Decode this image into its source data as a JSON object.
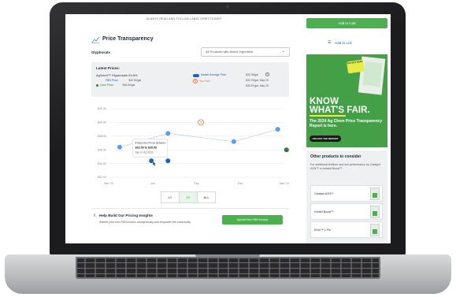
{
  "banner": "ALWAYS READ AND FOLLOW LABEL DIRECTIONS®",
  "header": {
    "title": "Price Transparency"
  },
  "product": {
    "label": "Glyphosate",
    "filter_value": "All Products with Active Ingredient"
  },
  "latest": {
    "title": "Latest Prices:",
    "product_name": "AgSavvi™ Glyphosate 53.8%",
    "fbn_label": "FBN Price:",
    "fbn_value": "$32.50/gal",
    "cash_label": "Cash Price:",
    "cash_value": "$36.50/gal",
    "market_label": "Market Average Price",
    "you_paid_label": "You Paid",
    "market_values": [
      "$32.09/gal",
      "$30.79/gal, May 25",
      "$35.97/gal, May 25"
    ]
  },
  "chart_data": {
    "type": "line",
    "x_labels": [
      "Mar '23",
      "Jun",
      "Sep",
      "Dec",
      "Mar '24"
    ],
    "y_labels": [
      "$32.00",
      "$34.00",
      "$36.00",
      "$38.00",
      "$40.00",
      "$42.00"
    ],
    "ylim": [
      32,
      42
    ],
    "series": [
      {
        "name": "Market Average Price",
        "color": "#5b9cf0",
        "points": [
          {
            "x": 0.25,
            "y": 36.4
          },
          {
            "x": 1.35,
            "y": 38.4
          },
          {
            "x": 2.85,
            "y": 37.2
          },
          {
            "x": 3.85,
            "y": 39.0
          }
        ]
      }
    ],
    "you_paid": {
      "x": 2.1,
      "y": 40.0,
      "color": "#e07a2b"
    },
    "fbn_point": {
      "x": 1.35,
      "y": 34.4,
      "color": "#1565c0"
    },
    "cash_point": {
      "x": 4.05,
      "y": 36.0,
      "color": "#2e7d32"
    },
    "tooltip": {
      "x": 0.8,
      "y": 37.6,
      "line1": "8 Reported Prices Between",
      "line2": "$33.59 to $35.50",
      "line3": "Sep to Oct 2023"
    },
    "grid": true
  },
  "tabs": [
    "1Y",
    "2Y",
    "ALL"
  ],
  "insights": {
    "title": "Help Build Our Pricing Insights",
    "text": "Submit your non-FBN invoice anonymously and empower the community.",
    "upload_label": "Upload Non-FBN Invoice"
  },
  "sidebar": {
    "cart_label": "Add to Cart",
    "list_label": "Add to List",
    "promo": {
      "sticker": "PAY NOT MORE",
      "headline1": "KNOW",
      "headline2": "WHAT'S FAIR.",
      "sub": "The 2024 Ag Chem Price Transparency Report is here.",
      "button": "UNLOCK THE REPORT"
    },
    "others": {
      "title": "Other products to consider",
      "desc": "For additional fertilizer and soil performance try Catalyst AZN™ or Inhabit Boost™",
      "items": [
        "Catalyst AZN™",
        "Inhabit Boost™",
        "Envir™ L Pro"
      ]
    }
  }
}
